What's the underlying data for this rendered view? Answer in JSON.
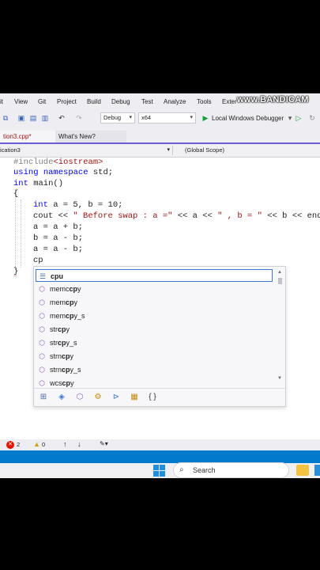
{
  "watermark": "www.BANDICAM",
  "menu": [
    "it",
    "View",
    "Git",
    "Project",
    "Build",
    "Debug",
    "Test",
    "Analyze",
    "Tools",
    "Exter"
  ],
  "toolbar": {
    "config": "Debug",
    "platform": "x64",
    "run_label": "Local Windows Debugger"
  },
  "tabs": {
    "active": "tion3.cpp*",
    "whatsnew": "What's New?"
  },
  "navbar": {
    "project": "ication3",
    "scope": "(Global Scope)"
  },
  "code": {
    "l1_pp": "#include",
    "l1_inc": "<iostream>",
    "l2_kw1": "using",
    "l2_kw2": "namespace",
    "l2_rest": " std;",
    "l3_kw": "int",
    "l3_rest": " main()",
    "l4": "{",
    "l5_kw": "int",
    "l5_rest": " a = 5, b = 10;",
    "l6_a": "cout << ",
    "l6_s1": "\" Before swap : a =\"",
    "l6_b": " << a << ",
    "l6_s2": "\" , b = \"",
    "l6_c": " << b << endl",
    "l7": "a = a + b;",
    "l8": "b = a - b;",
    "l9": "a = a - b;",
    "l10": "cp",
    "l11": "}"
  },
  "autocomplete": {
    "selected": "cpu",
    "items": [
      "memccpy",
      "memcpy",
      "memcpy_s",
      "strcpy",
      "strcpy_s",
      "strncpy",
      "strncpy_s",
      "wcscpy"
    ]
  },
  "status": {
    "errors": "2",
    "warnings": "0"
  },
  "taskbar": {
    "search_placeholder": "Search"
  }
}
